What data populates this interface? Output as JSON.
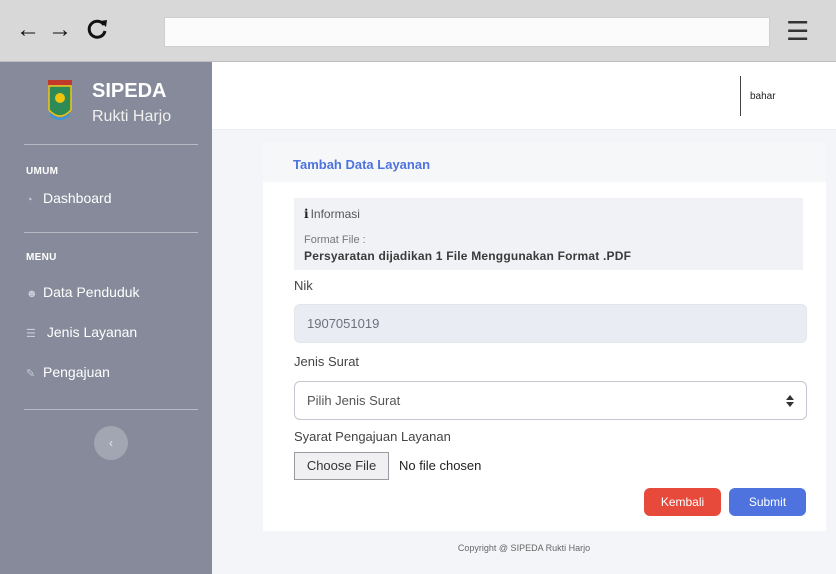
{
  "browser": {
    "back_icon": "←",
    "forward_icon": "→",
    "reload_icon": "↻",
    "menu_icon": "☰",
    "url": ""
  },
  "sidebar": {
    "brand_title": "SIPEDA",
    "brand_subtitle": "Rukti Harjo",
    "section_umum": "UMUM",
    "dashboard": "Dashboard",
    "section_menu": "MENU",
    "items": [
      {
        "label": "Data Penduduk",
        "icon": "users-icon"
      },
      {
        "label": "Jenis Layanan",
        "icon": "list-icon"
      },
      {
        "label": "Pengajuan",
        "icon": "edit-icon"
      }
    ],
    "collapse_icon": "‹"
  },
  "topbar": {
    "username": "bahar"
  },
  "form": {
    "card_title": "Tambah Data Layanan",
    "info_heading": "Informasi",
    "info_label": "Format File :",
    "info_text": "Persyaratan dijadikan 1 File Menggunakan Format .PDF",
    "nik_label": "Nik",
    "nik_value": "1907051019",
    "jenis_label": "Jenis Surat",
    "jenis_placeholder": "Pilih Jenis Surat",
    "syarat_label": "Syarat Pengajuan Layanan",
    "file_button": "Choose File",
    "file_status": "No file chosen",
    "back_button": "Kembali",
    "submit_button": "Submit"
  },
  "footer": {
    "copyright": "Copyright @ SIPEDA Rukti Harjo"
  },
  "colors": {
    "primary": "#4e73df",
    "danger": "#e74a3b",
    "sidebar": "#868a9a"
  }
}
